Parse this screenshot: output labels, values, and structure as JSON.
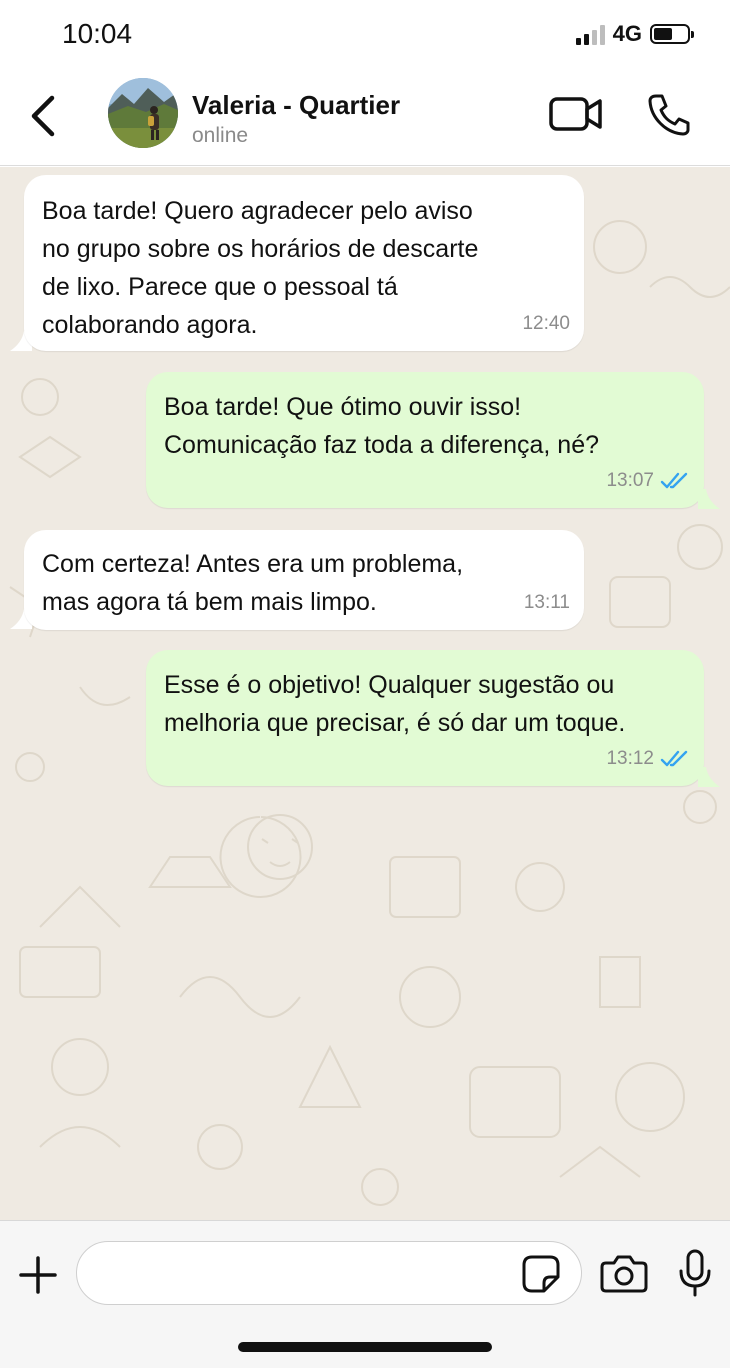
{
  "status_bar": {
    "time": "10:04",
    "network": "4G",
    "icons": [
      "signal-icon",
      "battery-icon"
    ]
  },
  "header": {
    "contact_name": "Valeria - Quartier",
    "contact_status": "online",
    "icons": [
      "back-arrow-icon",
      "avatar-photo",
      "video-camera-icon",
      "phone-icon"
    ]
  },
  "messages": [
    {
      "direction": "incoming",
      "text": "Boa tarde! Quero agradecer pelo aviso\nno grupo sobre os horários de descarte\nde lixo. Parece que o pessoal tá\ncolaborando agora.",
      "time": "12:40"
    },
    {
      "direction": "outgoing",
      "text": "Boa tarde! Que ótimo ouvir isso!\nComunicação faz toda a diferença, né?",
      "time": "13:07",
      "read": true
    },
    {
      "direction": "incoming",
      "text": "Com certeza! Antes era um problema,\nmas agora tá bem mais limpo.",
      "time": "13:11"
    },
    {
      "direction": "outgoing",
      "text": "Esse é o objetivo! Qualquer sugestão ou\nmelhoria que precisar, é só dar um toque.",
      "time": "13:12",
      "read": true
    }
  ],
  "input_bar": {
    "placeholder": "",
    "icons": [
      "plus-icon",
      "sticker-icon",
      "camera-icon",
      "microphone-icon"
    ]
  },
  "colors": {
    "chat_background": "#efeae2",
    "incoming_bubble": "#ffffff",
    "outgoing_bubble": "#e2fbd4",
    "read_ticks": "#34a3f0",
    "timestamp": "#8c8c8c"
  }
}
